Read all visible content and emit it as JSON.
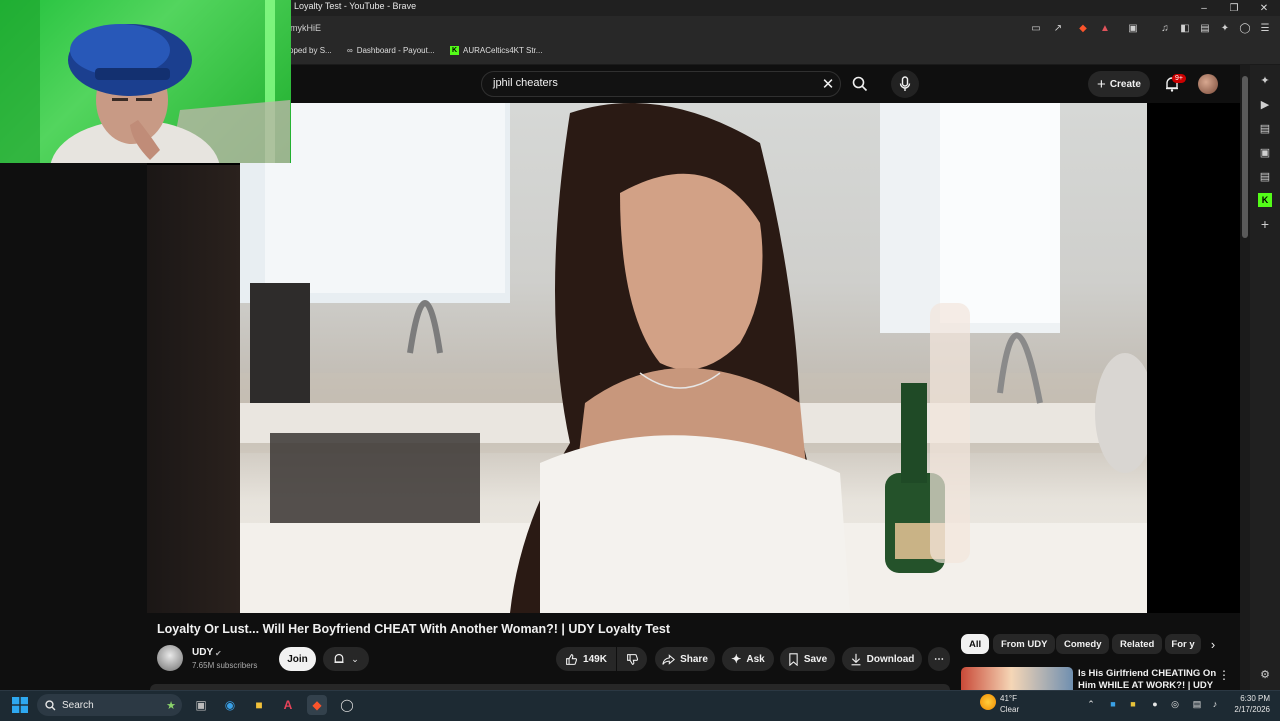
{
  "browser": {
    "window_title": "Loyalty Test - YouTube - Brave",
    "address": "mykHiE",
    "bookmarks": [
      "pped by S...",
      "Dashboard - Payout...",
      "AURACeltics4KT Str..."
    ]
  },
  "youtube": {
    "search_value": "jphil cheaters",
    "create_label": "Create",
    "notification_count": "9+"
  },
  "video": {
    "title": "Loyalty Or Lust... Will Her Boyfriend CHEAT With Another Woman?! | UDY Loyalty Test",
    "channel_name": "UDY",
    "subscribers": "7.65M subscribers",
    "join_label": "Join",
    "like_count": "149K",
    "share_label": "Share",
    "ask_label": "Ask",
    "save_label": "Save",
    "download_label": "Download"
  },
  "chips": [
    "All",
    "From UDY",
    "Comedy",
    "Related",
    "For y"
  ],
  "recommendation": {
    "title": "Is His Girlfriend CHEATING On Him WHILE AT WORK?! | UDY"
  },
  "taskbar": {
    "search_label": "Search",
    "weather_temp": "41°F",
    "weather_cond": "Clear",
    "time": "6:30 PM",
    "date": "2/17/2026"
  },
  "colors": {
    "yt_bg": "#0f0f0f",
    "pill_bg": "#272727",
    "accent_red": "#cc0000",
    "webcam_green": "#2ecc40"
  }
}
